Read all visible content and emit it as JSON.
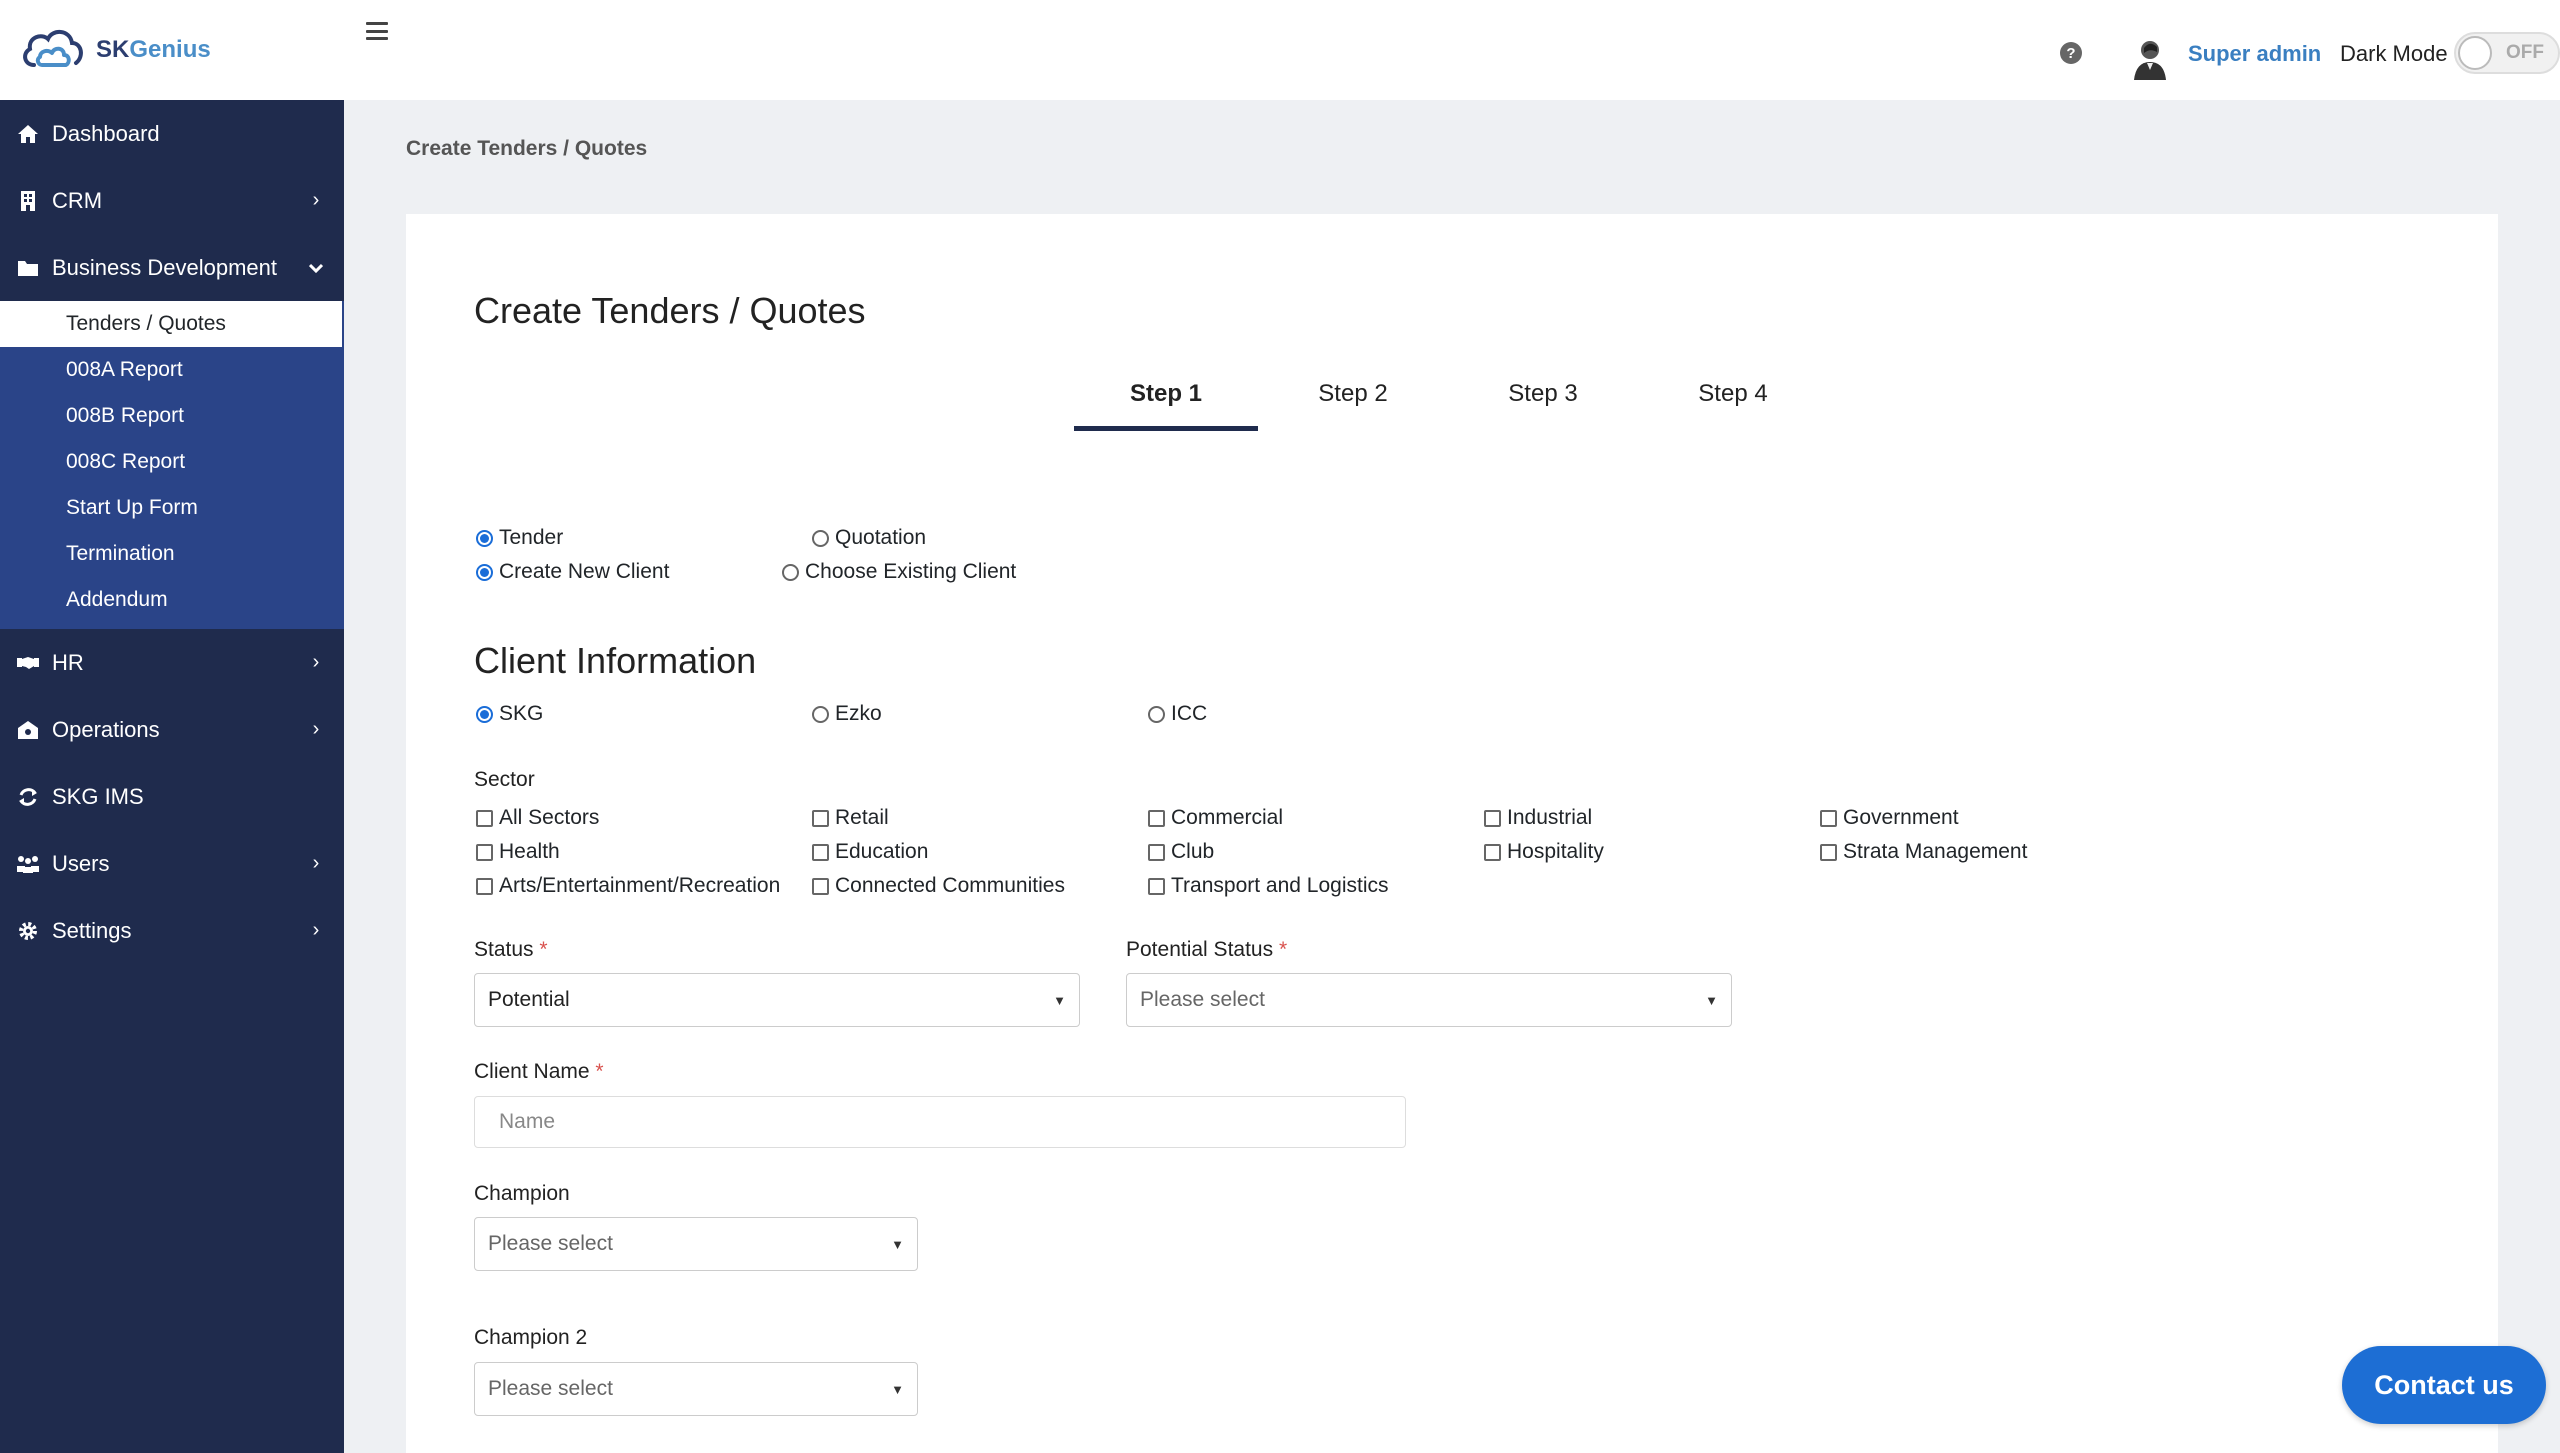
{
  "brand": {
    "name_part1": "SK",
    "name_part2": "Genius"
  },
  "sidebar": {
    "items": [
      {
        "label": "Dashboard",
        "icon": "home-icon"
      },
      {
        "label": "CRM",
        "icon": "building-icon"
      },
      {
        "label": "Business Development",
        "icon": "folder-icon"
      },
      {
        "label": "HR",
        "icon": "handshake-icon"
      },
      {
        "label": "Operations",
        "icon": "operations-icon"
      },
      {
        "label": "SKG IMS",
        "icon": "sync-icon"
      },
      {
        "label": "Users",
        "icon": "users-icon"
      },
      {
        "label": "Settings",
        "icon": "gear-icon"
      }
    ],
    "submenu": [
      "Tenders / Quotes",
      "008A Report",
      "008B Report",
      "008C Report",
      "Start Up Form",
      "Termination",
      "Addendum"
    ]
  },
  "topbar": {
    "user_name": "Super admin",
    "dark_mode_label": "Dark Mode",
    "toggle_state": "OFF",
    "help_glyph": "?"
  },
  "breadcrumb": "Create Tenders / Quotes",
  "form": {
    "title": "Create Tenders / Quotes",
    "steps": [
      "Step 1",
      "Step 2",
      "Step 3",
      "Step 4"
    ],
    "type_options": [
      "Tender",
      "Quotation"
    ],
    "client_options": [
      "Create New Client",
      "Choose Existing Client"
    ],
    "client_info_title": "Client Information",
    "company_options": [
      "SKG",
      "Ezko",
      "ICC"
    ],
    "sector_label": "Sector",
    "sectors": [
      "All Sectors",
      "Retail",
      "Commercial",
      "Industrial",
      "Government",
      "Health",
      "Education",
      "Club",
      "Hospitality",
      "Strata Management",
      "Arts/Entertainment/Recreation",
      "Connected Communities",
      "Transport and Logistics"
    ],
    "status_label": "Status",
    "status_value": "Potential",
    "potential_status_label": "Potential Status",
    "potential_status_placeholder": "Please select",
    "client_name_label": "Client Name",
    "client_name_placeholder": "Name",
    "champion_label": "Champion",
    "champion_placeholder": "Please select",
    "champion2_label": "Champion 2",
    "champion2_placeholder": "Please select",
    "required_mark": "*"
  },
  "contact_button": "Contact us",
  "colors": {
    "sidebar": "#1f2b4d",
    "submenu": "#2a4488",
    "accent": "#1d6ed4",
    "user_name": "#3a7fc1"
  }
}
